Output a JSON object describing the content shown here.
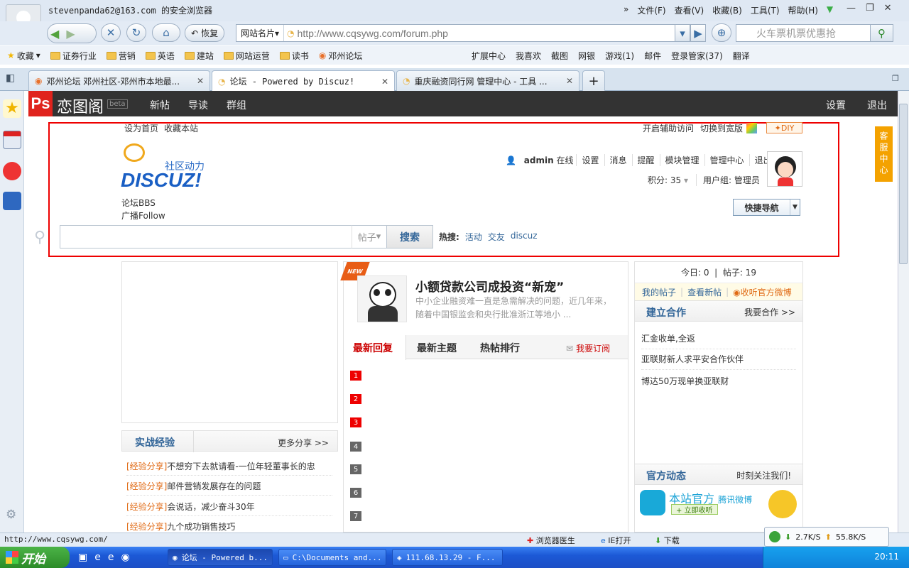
{
  "window": {
    "title": "stevenpanda62@163.com 的安全浏览器",
    "menu": [
      "文件(F)",
      "查看(V)",
      "收藏(B)",
      "工具(T)",
      "帮助(H)"
    ]
  },
  "navbar": {
    "restore_label": "恢复",
    "site_card_label": "网站名片",
    "url": "http://www.cqsywg.com/forum.php",
    "search_placeholder": "火车票机票优惠抢"
  },
  "bookmarks": {
    "left": [
      "收藏",
      "证券行业",
      "营销",
      "英语",
      "建站",
      "网站运营",
      "读书",
      "邓州论坛"
    ],
    "right": [
      "扩展中心",
      "我喜欢",
      "截图",
      "网银",
      "游戏(1)",
      "邮件",
      "登录管家(37)",
      "翻译"
    ]
  },
  "tabs": [
    {
      "label": "邓州论坛 邓州社区-邓州市本地最..."
    },
    {
      "label": "论坛 - Powered by Discuz!"
    },
    {
      "label": "重庆融资同行网 管理中心 - 工具 ..."
    }
  ],
  "site": {
    "name": "恋图阁",
    "beta": "beta",
    "nav": [
      "新帖",
      "导读",
      "群组"
    ],
    "right_nav": [
      "设置",
      "退出"
    ]
  },
  "discuz": {
    "top_left": [
      "设为首页",
      "收藏本站"
    ],
    "top_right": [
      "开启辅助访问",
      "切换到宽版"
    ],
    "diy": "DIY",
    "kefu": "客服中心",
    "logo_cn": "社区动力",
    "logo_en": "DISCUZ!",
    "bbs": "论坛BBS",
    "follow": "广播Follow",
    "user": {
      "name": "admin",
      "status": "在线",
      "links": [
        "设置",
        "消息",
        "提醒",
        "模块管理",
        "管理中心",
        "退出"
      ],
      "credits": "积分: 35",
      "group": "用户组: 管理员"
    },
    "quick_nav": "快捷导航",
    "search": {
      "type": "帖子",
      "button": "搜索",
      "hot_label": "热搜:",
      "hot": [
        "活动",
        "交友",
        "discuz"
      ]
    }
  },
  "middle": {
    "new_badge": "NEW",
    "headline": "小额贷款公司成投资“新宠”",
    "summary": "中小企业融资难一直是急需解决的问题，近几年来，随着中国银监会和央行批准浙江等地小 ...",
    "tabs": [
      "最新回复",
      "最新主题",
      "热帖排行"
    ],
    "subscribe": "我要订阅",
    "numbers": [
      "1",
      "2",
      "3",
      "4",
      "5",
      "6",
      "7"
    ]
  },
  "shizhan": {
    "title": "实战经验",
    "more": "更多分享 >>",
    "items": [
      {
        "tag": "[经验分享]",
        "text": "不想穷下去就请看-一位年轻董事长的忠"
      },
      {
        "tag": "[经验分享]",
        "text": "邮件营销发展存在的问题"
      },
      {
        "tag": "[经验分享]",
        "text": "会说话，减少奋斗30年"
      },
      {
        "tag": "[经验分享]",
        "text": "九个成功销售技巧"
      }
    ]
  },
  "right": {
    "stats": "今日: 0  |  帖子: 19",
    "links": [
      "我的帖子",
      "查看新帖",
      "收听官方微博"
    ],
    "coop_title": "建立合作",
    "coop_more": "我要合作 >>",
    "coop_items": [
      "汇金收单,全返",
      "亚联财新人求平安合作伙伴",
      "博达50万现单换亚联财"
    ],
    "official_title": "官方动态",
    "official_more": "时刻关注我们!",
    "weibo_title": "本站官方",
    "weibo_sub": "腾讯微博",
    "weibo_btn": "+ 立即收听"
  },
  "statusbar": {
    "url": "http://www.cqsywg.com/",
    "items": [
      "浏览器医生",
      "IE打开",
      "下载"
    ],
    "down": "2.7K/S",
    "up": "55.8K/S"
  },
  "taskbar": {
    "start": "开始",
    "tasks": [
      "论坛 - Powered b...",
      "C:\\Documents and...",
      "111.68.13.29 - F..."
    ],
    "time": "20:11"
  }
}
